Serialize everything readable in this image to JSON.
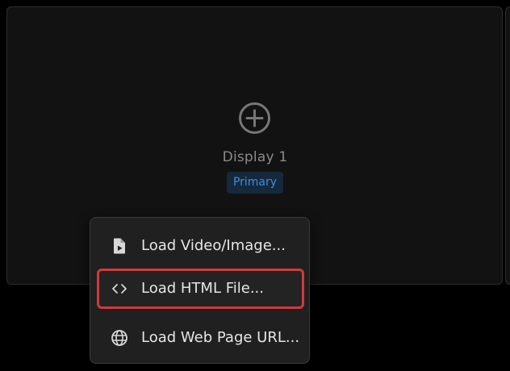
{
  "display": {
    "name": "Display 1",
    "badge": "Primary",
    "add_icon": "plus-circle-icon"
  },
  "context_menu": {
    "items": [
      {
        "label": "Load Video/Image...",
        "icon": "file-media-icon"
      },
      {
        "label": "Load HTML File...",
        "icon": "code-icon",
        "highlighted": true
      },
      {
        "label": "Load Web Page URL...",
        "icon": "globe-icon"
      }
    ]
  },
  "colors": {
    "background": "#000000",
    "card": "#121212",
    "menu": "#202020",
    "badge_bg": "#16283b",
    "badge_text": "#3b8fe0",
    "highlight_border": "#d13a3a"
  }
}
